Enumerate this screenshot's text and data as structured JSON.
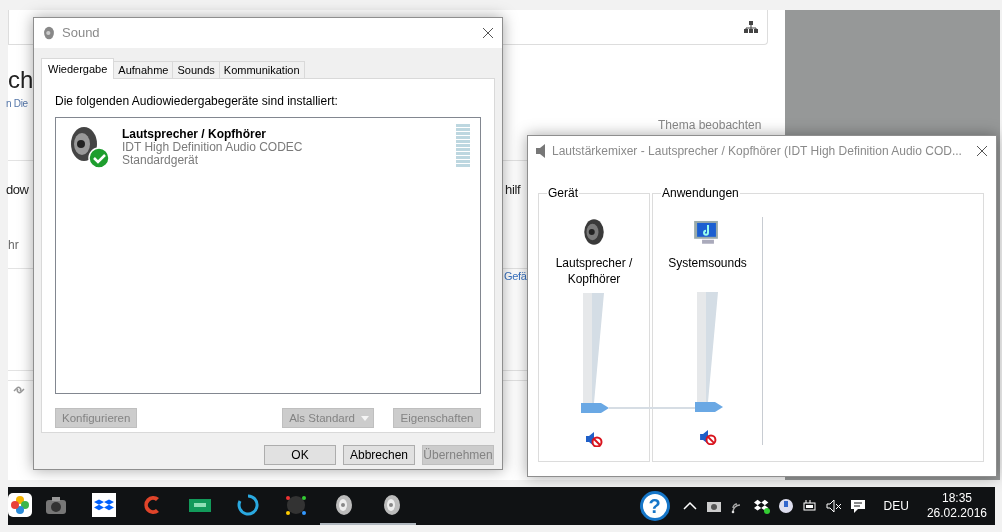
{
  "background_page": {
    "heading": "ch",
    "subheading": "n Die",
    "row_title": "dow",
    "row_note": "hr",
    "side_title": "hilf",
    "side_link": "Gefä",
    "watch_link": "Thema beobachten"
  },
  "sound_dialog": {
    "title": "Sound",
    "tabs": [
      {
        "label": "Wiedergabe",
        "selected": true
      },
      {
        "label": "Aufnahme",
        "selected": false
      },
      {
        "label": "Sounds",
        "selected": false
      },
      {
        "label": "Kommunikation",
        "selected": false
      }
    ],
    "instruction": "Die folgenden Audiowiedergabegeräte sind installiert:",
    "devices": [
      {
        "name": "Lautsprecher / Kopfhörer",
        "driver": "IDT High Definition Audio CODEC",
        "status": "Standardgerät",
        "default": true
      }
    ],
    "actions": [
      {
        "label": "Konfigurieren",
        "disabled": true,
        "dropdown": false
      },
      {
        "label": "Als Standard",
        "disabled": true,
        "dropdown": true
      },
      {
        "label": "Eigenschaften",
        "disabled": true,
        "dropdown": false
      }
    ],
    "footer_buttons": [
      {
        "label": "OK",
        "disabled": false
      },
      {
        "label": "Abbrechen",
        "disabled": false
      },
      {
        "label": "Übernehmen",
        "disabled": true
      }
    ]
  },
  "mixer": {
    "title": "Lautstärkemixer - Lautsprecher / Kopfhörer (IDT High Definition Audio COD...",
    "groups": [
      {
        "label": "Gerät",
        "channels": [
          {
            "name": "Lautsprecher / Kopfhörer",
            "kind": "speaker",
            "level": 0,
            "muted": true
          }
        ]
      },
      {
        "label": "Anwendungen",
        "channels": [
          {
            "name": "Systemsounds",
            "kind": "monitor",
            "level": 0,
            "muted": true
          }
        ]
      }
    ]
  },
  "taskbar": {
    "apps": [
      {
        "kind": "photos",
        "running": false
      },
      {
        "kind": "camera",
        "running": false
      },
      {
        "kind": "dropbox",
        "running": false
      },
      {
        "kind": "ccleaner",
        "running": false
      },
      {
        "kind": "board",
        "running": false
      },
      {
        "kind": "ring",
        "running": false
      },
      {
        "kind": "disc",
        "running": false
      },
      {
        "kind": "speaker",
        "running": true
      },
      {
        "kind": "speaker",
        "running": true
      }
    ],
    "help": "?",
    "language": "DEU",
    "time": "18:35",
    "date": "26.02.2016"
  }
}
